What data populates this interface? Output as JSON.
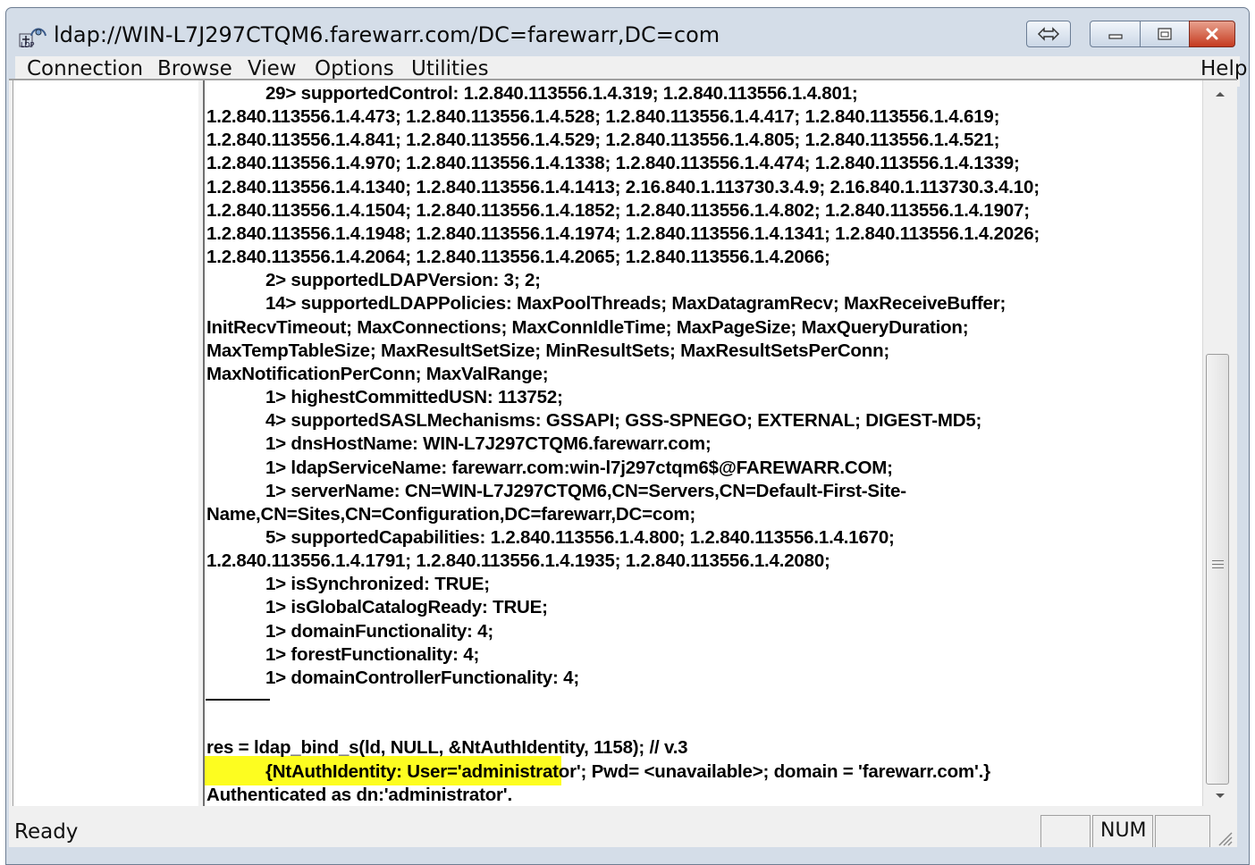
{
  "window": {
    "title": "ldap://WIN-L7J297CTQM6.farewarr.com/DC=farewarr,DC=com"
  },
  "icons": {
    "app": "ldp-app-icon",
    "swap": "swap-arrows-icon",
    "minimize": "minimize-icon",
    "maximize": "maximize-icon",
    "close": "close-icon"
  },
  "menu": {
    "connection": "Connection",
    "browse": "Browse",
    "view": "View",
    "options": "Options",
    "utilities": "Utilities",
    "help": "Help"
  },
  "output": {
    "text": "            29> supportedControl: 1.2.840.113556.1.4.319; 1.2.840.113556.1.4.801;\n1.2.840.113556.1.4.473; 1.2.840.113556.1.4.528; 1.2.840.113556.1.4.417; 1.2.840.113556.1.4.619;\n1.2.840.113556.1.4.841; 1.2.840.113556.1.4.529; 1.2.840.113556.1.4.805; 1.2.840.113556.1.4.521;\n1.2.840.113556.1.4.970; 1.2.840.113556.1.4.1338; 1.2.840.113556.1.4.474; 1.2.840.113556.1.4.1339;\n1.2.840.113556.1.4.1340; 1.2.840.113556.1.4.1413; 2.16.840.1.113730.3.4.9; 2.16.840.1.113730.3.4.10;\n1.2.840.113556.1.4.1504; 1.2.840.113556.1.4.1852; 1.2.840.113556.1.4.802; 1.2.840.113556.1.4.1907;\n1.2.840.113556.1.4.1948; 1.2.840.113556.1.4.1974; 1.2.840.113556.1.4.1341; 1.2.840.113556.1.4.2026;\n1.2.840.113556.1.4.2064; 1.2.840.113556.1.4.2065; 1.2.840.113556.1.4.2066;\n            2> supportedLDAPVersion: 3; 2;\n            14> supportedLDAPPolicies: MaxPoolThreads; MaxDatagramRecv; MaxReceiveBuffer;\nInitRecvTimeout; MaxConnections; MaxConnIdleTime; MaxPageSize; MaxQueryDuration;\nMaxTempTableSize; MaxResultSetSize; MinResultSets; MaxResultSetsPerConn;\nMaxNotificationPerConn; MaxValRange;\n            1> highestCommittedUSN: 113752;\n            4> supportedSASLMechanisms: GSSAPI; GSS-SPNEGO; EXTERNAL; DIGEST-MD5;\n            1> dnsHostName: WIN-L7J297CTQM6.farewarr.com;\n            1> ldapServiceName: farewarr.com:win-l7j297ctqm6$@FAREWARR.COM;\n            1> serverName: CN=WIN-L7J297CTQM6,CN=Servers,CN=Default-First-Site-\nName,CN=Sites,CN=Configuration,DC=farewarr,DC=com;\n            5> supportedCapabilities: 1.2.840.113556.1.4.800; 1.2.840.113556.1.4.1670;\n1.2.840.113556.1.4.1791; 1.2.840.113556.1.4.1935; 1.2.840.113556.1.4.2080;\n            1> isSynchronized: TRUE;\n            1> isGlobalCatalogReady: TRUE;\n            1> domainFunctionality: 4;\n            1> forestFunctionality: 4;\n            1> domainControllerFunctionality: 4;\n\n\nres = ldap_bind_s(ld, NULL, &NtAuthIdentity, 1158); // v.3\n            {NtAuthIdentity: User='administrator'; Pwd= <unavailable>; domain = 'farewarr.com'.}\nAuthenticated as dn:'administrator'."
  },
  "status": {
    "text": "Ready",
    "panel1": "",
    "panel2": "NUM",
    "panel3": ""
  },
  "colors": {
    "highlight": "#fdfd20",
    "title_bar": "#d4dde8",
    "close_button": "#c53a1f"
  }
}
